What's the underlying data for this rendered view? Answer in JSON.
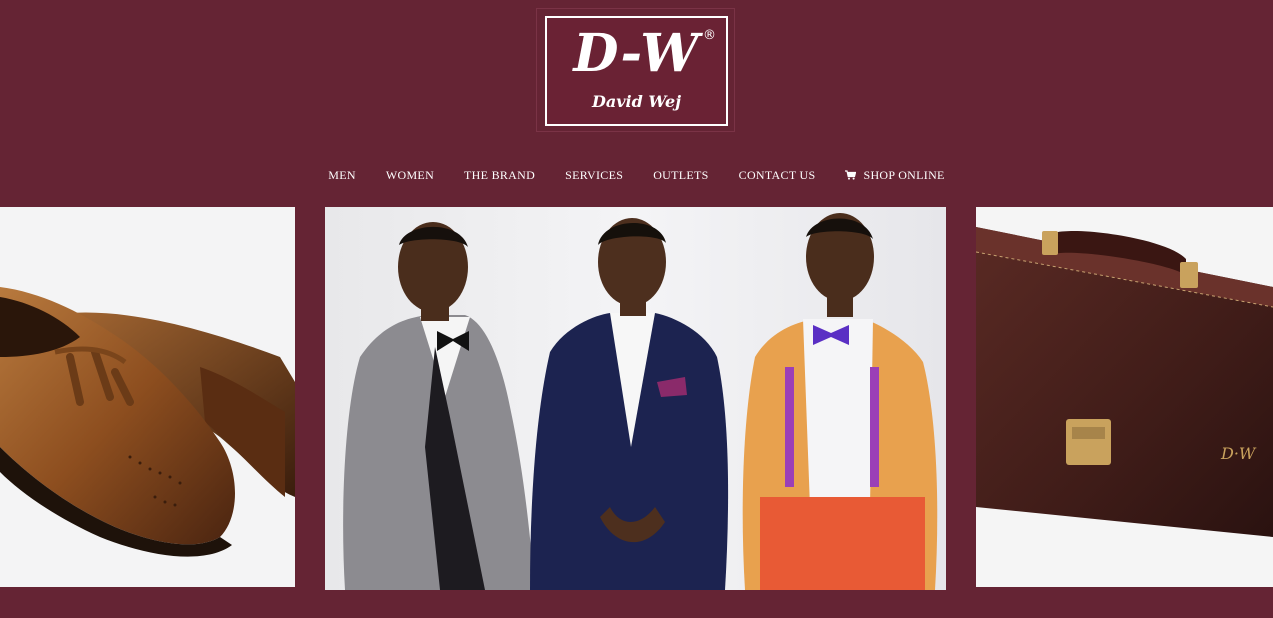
{
  "logo": {
    "main": "D-W",
    "registered": "®",
    "sub": "David Wej"
  },
  "nav": {
    "items": [
      {
        "label": "MEN"
      },
      {
        "label": "WOMEN"
      },
      {
        "label": "THE BRAND"
      },
      {
        "label": "SERVICES"
      },
      {
        "label": "OUTLETS"
      },
      {
        "label": "CONTACT US"
      },
      {
        "label": "SHOP ONLINE",
        "icon": "cart-icon"
      }
    ]
  },
  "images": {
    "left": "shoe-image",
    "center": "models-image",
    "right": "briefcase-image"
  },
  "colors": {
    "background": "#652434",
    "text": "#ffffff"
  }
}
